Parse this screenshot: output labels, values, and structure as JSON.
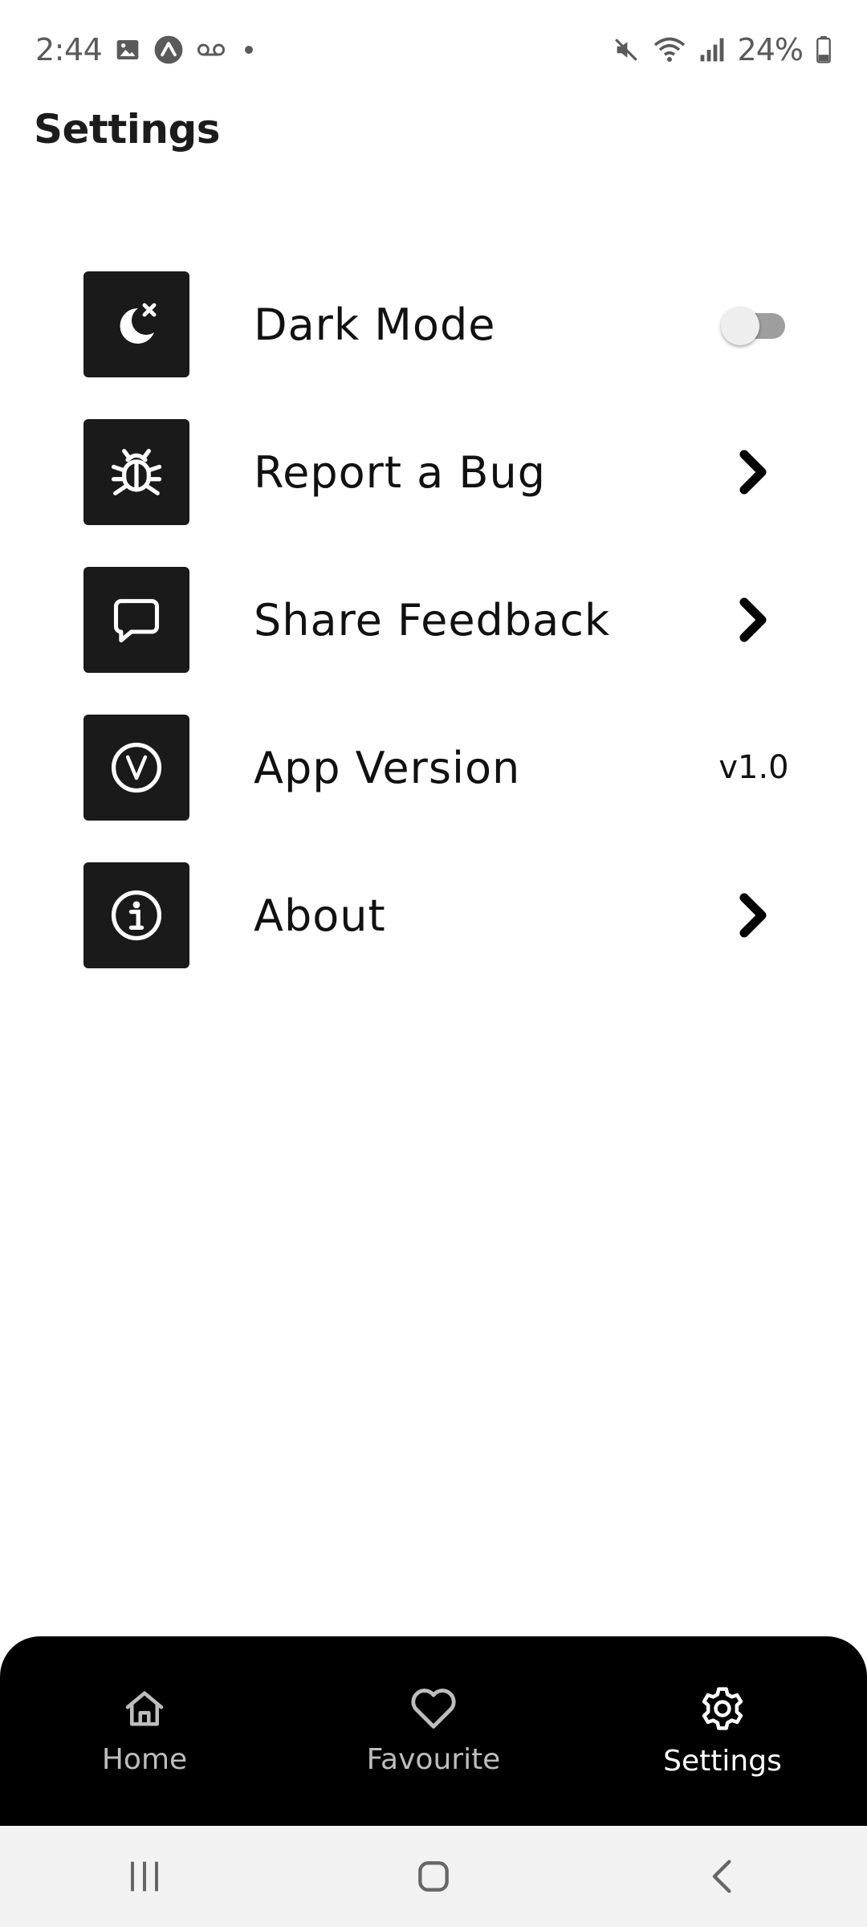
{
  "status_bar": {
    "time": "2:44",
    "battery": "24%"
  },
  "page": {
    "title": "Settings"
  },
  "settings": {
    "items": [
      {
        "label": "Dark Mode",
        "icon": "moon-icon",
        "trailing": "toggle",
        "toggle_on": false
      },
      {
        "label": "Report a Bug",
        "icon": "bug-icon",
        "trailing": "chevron"
      },
      {
        "label": "Share Feedback",
        "icon": "chat-bubble-icon",
        "trailing": "chevron"
      },
      {
        "label": "App Version",
        "icon": "version-icon",
        "trailing": "value",
        "value": "v1.0"
      },
      {
        "label": "About",
        "icon": "info-icon",
        "trailing": "chevron"
      }
    ]
  },
  "bottom_nav": {
    "items": [
      {
        "label": "Home",
        "icon": "home-icon",
        "active": false
      },
      {
        "label": "Favourite",
        "icon": "heart-icon",
        "active": false
      },
      {
        "label": "Settings",
        "icon": "gear-icon",
        "active": true
      }
    ]
  },
  "colors": {
    "icon_tile": "#1a1a1a",
    "nav_background": "#000000",
    "nav_inactive": "#bdbdbd",
    "nav_active": "#ffffff"
  }
}
